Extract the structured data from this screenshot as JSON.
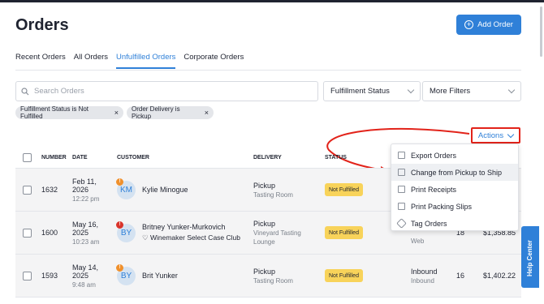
{
  "page": {
    "title": "Orders",
    "add_button": "Add Order"
  },
  "tabs": [
    "Recent Orders",
    "All Orders",
    "Unfulfilled Orders",
    "Corporate Orders"
  ],
  "search": {
    "placeholder": "Search Orders"
  },
  "filters": {
    "fulfillment": "Fulfillment Status",
    "more": "More Filters"
  },
  "chips": [
    "Fulfillment Status is Not Fulfilled",
    "Order Delivery is Pickup"
  ],
  "actions": {
    "label": "Actions"
  },
  "table": {
    "headers": [
      "NUMBER",
      "DATE",
      "CUSTOMER",
      "DELIVERY",
      "STATUS"
    ],
    "rows": [
      {
        "number": "1632",
        "date": "Feb 11,",
        "date2": "2026",
        "time": "12:22 pm",
        "initials": "KM",
        "flag": "!",
        "customer": "Kylie Minogue",
        "club": "",
        "delivery": "Pickup",
        "location": "Tasting Room",
        "location2": "",
        "status": "Not Fulfilled",
        "source": "",
        "source2": "",
        "qty": "",
        "total": ""
      },
      {
        "number": "1600",
        "date": "May 16,",
        "date2": "2025",
        "time": "10:23 am",
        "initials": "BY",
        "flag": "!",
        "customer": "Britney Yunker-Murkovich",
        "club": "♡ Winemaker Select Case Club",
        "delivery": "Pickup",
        "location": "Vineyard Tasting",
        "location2": "Lounge",
        "status": "Not Fulfilled",
        "source": "",
        "source2": "Web",
        "qty": "18",
        "total": "$1,358.85"
      },
      {
        "number": "1593",
        "date": "May 14,",
        "date2": "2025",
        "time": "9:48 am",
        "initials": "BY",
        "flag": "!",
        "customer": "Brit Yunker",
        "club": "",
        "delivery": "Pickup",
        "location": "Tasting Room",
        "location2": "",
        "status": "Not Fulfilled",
        "source": "Inbound",
        "source2": "Inbound",
        "qty": "16",
        "total": "$1,402.22"
      }
    ]
  },
  "menu": {
    "items": [
      "Export Orders",
      "Change from Pickup to Ship",
      "Print Receipts",
      "Print Packing Slips",
      "Tag Orders"
    ]
  },
  "help": {
    "label": "Help Center"
  },
  "colors": {
    "accent": "#2f80d8",
    "highlight": "#e2231a",
    "badge": "#f8d35a"
  }
}
